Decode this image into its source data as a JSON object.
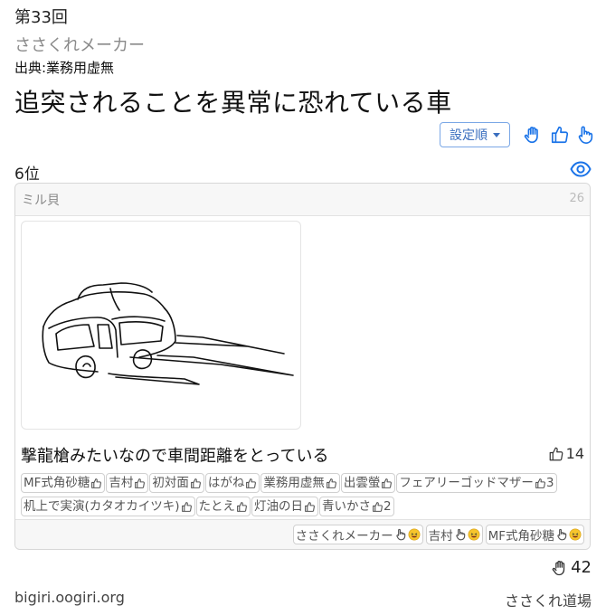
{
  "header": {
    "round": "第33回",
    "host": "ささくれメーカー",
    "source": "出典:業務用虚無",
    "theme": "追突されることを異常に恐れている車"
  },
  "toolbar": {
    "sort_label": "設定順",
    "icons": [
      "hand-icon",
      "thumbs-up-icon",
      "pointing-hand-icon"
    ]
  },
  "rank": "6位",
  "card": {
    "author": "ミル貝",
    "count": "26",
    "answer": "撃龍槍みたいなので車間距離をとっている",
    "answer_likes": "14",
    "voters": [
      {
        "name": "MF式角砂糖",
        "count": ""
      },
      {
        "name": "吉村",
        "count": ""
      },
      {
        "name": "初対面",
        "count": ""
      },
      {
        "name": "はがね",
        "count": ""
      },
      {
        "name": "業務用虚無",
        "count": ""
      },
      {
        "name": "出雲螢",
        "count": ""
      },
      {
        "name": "フェアリーゴッドマザー",
        "count": "3"
      },
      {
        "name": "机上で実演(カタオカイツキ)",
        "count": ""
      },
      {
        "name": "たとえ",
        "count": ""
      },
      {
        "name": "灯油の日",
        "count": ""
      },
      {
        "name": "青いかさ",
        "count": "2"
      }
    ],
    "reactions": [
      {
        "name": "ささくれメーカー",
        "emoji": "rofl-emoji"
      },
      {
        "name": "吉村",
        "emoji": "laughing-emoji"
      },
      {
        "name": "MF式角砂糖",
        "emoji": "laughing-emoji"
      }
    ]
  },
  "total_hands": "42",
  "footer": {
    "site": "bigiri.oogiri.org",
    "dojo": "ささくれ道場"
  },
  "colors": {
    "accent": "#1a73e8",
    "border": "#d7d7d7",
    "muted": "#888888"
  }
}
